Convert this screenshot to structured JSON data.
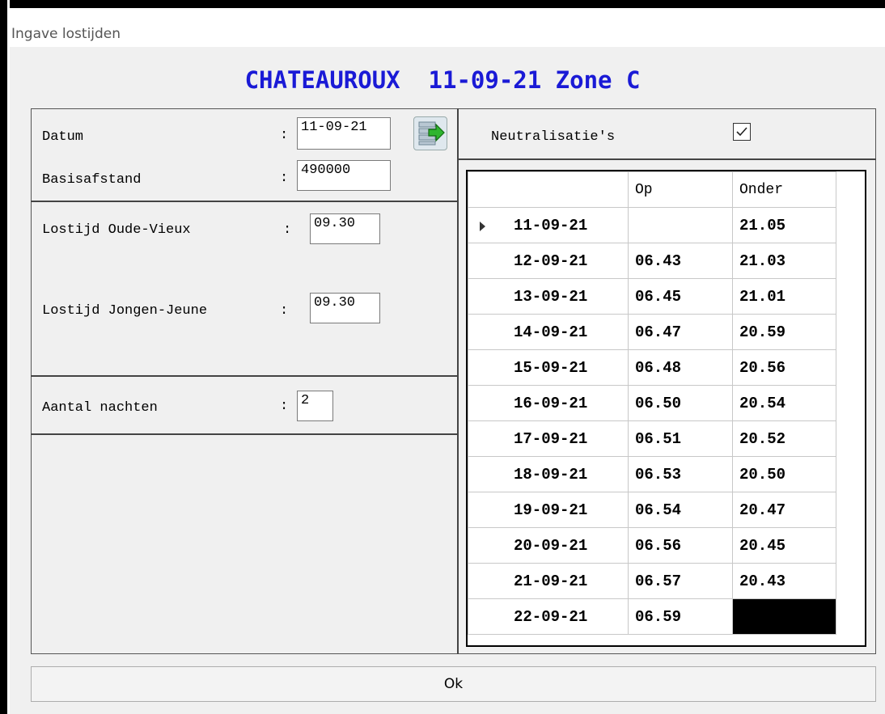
{
  "window": {
    "title": "Ingave lostijden"
  },
  "heading": "CHATEAUROUX  11-09-21 Zone C",
  "form": {
    "datum_label": "Datum",
    "datum_colon": ":",
    "datum_value": "11-09-21",
    "basisafstand_label": "Basisafstand",
    "basisafstand_colon": ":",
    "basisafstand_value": "490000",
    "oude_label": "Lostijd Oude-Vieux",
    "oude_colon": ":",
    "oude_value": "09.30",
    "jongen_label": "Lostijd Jongen-Jeune",
    "jongen_colon": ":",
    "jongen_value": "09.30",
    "nachten_label": "Aantal nachten",
    "nachten_colon": ":",
    "nachten_value": "2"
  },
  "neutralisatie": {
    "label": "Neutralisatie's",
    "checked": true,
    "check_glyph": "✓"
  },
  "grid": {
    "headers": [
      "",
      "Op",
      "Onder"
    ],
    "rows": [
      {
        "date": "11-09-21",
        "op": "",
        "onder": "21.05"
      },
      {
        "date": "12-09-21",
        "op": "06.43",
        "onder": "21.03"
      },
      {
        "date": "13-09-21",
        "op": "06.45",
        "onder": "21.01"
      },
      {
        "date": "14-09-21",
        "op": "06.47",
        "onder": "20.59"
      },
      {
        "date": "15-09-21",
        "op": "06.48",
        "onder": "20.56"
      },
      {
        "date": "16-09-21",
        "op": "06.50",
        "onder": "20.54"
      },
      {
        "date": "17-09-21",
        "op": "06.51",
        "onder": "20.52"
      },
      {
        "date": "18-09-21",
        "op": "06.53",
        "onder": "20.50"
      },
      {
        "date": "19-09-21",
        "op": "06.54",
        "onder": "20.47"
      },
      {
        "date": "20-09-21",
        "op": "06.56",
        "onder": "20.45"
      },
      {
        "date": "21-09-21",
        "op": "06.57",
        "onder": "20.43"
      },
      {
        "date": "22-09-21",
        "op": "06.59",
        "onder": ""
      }
    ]
  },
  "ok_label": "Ok",
  "icons": {
    "import": "arrow-import-icon",
    "row_indicator": "row-indicator-icon"
  },
  "colors": {
    "heading": "#1a1ad6",
    "selected_cell": "#000000"
  }
}
